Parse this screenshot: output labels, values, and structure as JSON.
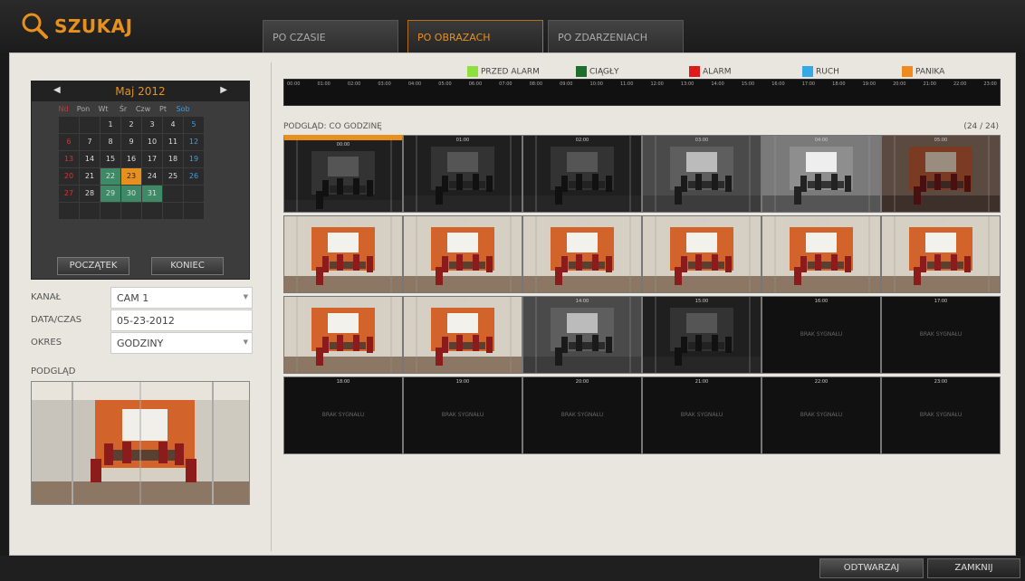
{
  "header": {
    "title": "SZUKAJ",
    "tabs": [
      {
        "label": "PO CZASIE",
        "active": false
      },
      {
        "label": "PO OBRAZACH",
        "active": true
      },
      {
        "label": "PO ZDARZENIACH",
        "active": false
      }
    ]
  },
  "calendar": {
    "month": "Maj 2012",
    "weekdays": [
      "Nd",
      "Pon",
      "Wt",
      "Śr",
      "Czw",
      "Pt",
      "Sob"
    ],
    "days": [
      {
        "d": "",
        "c": "empty"
      },
      {
        "d": "",
        "c": "empty"
      },
      {
        "d": "1",
        "c": ""
      },
      {
        "d": "2",
        "c": ""
      },
      {
        "d": "3",
        "c": ""
      },
      {
        "d": "4",
        "c": ""
      },
      {
        "d": "5",
        "c": "blue"
      },
      {
        "d": "6",
        "c": "red"
      },
      {
        "d": "7",
        "c": ""
      },
      {
        "d": "8",
        "c": ""
      },
      {
        "d": "9",
        "c": ""
      },
      {
        "d": "10",
        "c": ""
      },
      {
        "d": "11",
        "c": ""
      },
      {
        "d": "12",
        "c": "blue"
      },
      {
        "d": "13",
        "c": "red"
      },
      {
        "d": "14",
        "c": ""
      },
      {
        "d": "15",
        "c": ""
      },
      {
        "d": "16",
        "c": ""
      },
      {
        "d": "17",
        "c": ""
      },
      {
        "d": "18",
        "c": ""
      },
      {
        "d": "19",
        "c": "blue"
      },
      {
        "d": "20",
        "c": "red"
      },
      {
        "d": "21",
        "c": ""
      },
      {
        "d": "22",
        "c": "green"
      },
      {
        "d": "23",
        "c": "sel"
      },
      {
        "d": "24",
        "c": ""
      },
      {
        "d": "25",
        "c": ""
      },
      {
        "d": "26",
        "c": "blue"
      },
      {
        "d": "27",
        "c": "red"
      },
      {
        "d": "28",
        "c": ""
      },
      {
        "d": "29",
        "c": "green"
      },
      {
        "d": "30",
        "c": "green"
      },
      {
        "d": "31",
        "c": "green"
      },
      {
        "d": "",
        "c": "empty"
      },
      {
        "d": "",
        "c": "empty"
      },
      {
        "d": "",
        "c": "empty"
      },
      {
        "d": "",
        "c": "empty"
      },
      {
        "d": "",
        "c": "empty"
      },
      {
        "d": "",
        "c": "empty"
      },
      {
        "d": "",
        "c": "empty"
      },
      {
        "d": "",
        "c": "empty"
      },
      {
        "d": "",
        "c": "empty"
      }
    ],
    "start_label": "POCZĄTEK",
    "end_label": "KONIEC"
  },
  "form": {
    "channel_label": "KANAŁ",
    "channel_value": "CAM 1",
    "datetime_label": "DATA/CZAS",
    "datetime_value": "05-23-2012",
    "period_label": "OKRES",
    "period_value": "GODZINY",
    "preview_label": "PODGLĄD"
  },
  "legend": [
    {
      "label": "PRZED ALARM",
      "color": "#8fe03c"
    },
    {
      "label": "CIĄGŁY",
      "color": "#1e6e2e"
    },
    {
      "label": "ALARM",
      "color": "#e01a1a"
    },
    {
      "label": "RUCH",
      "color": "#35a8e8"
    },
    {
      "label": "PANIKA",
      "color": "#f08a1e"
    }
  ],
  "timeline_ticks": [
    "00:00",
    "01:00",
    "02:00",
    "03:00",
    "04:00",
    "05:00",
    "06:00",
    "07:00",
    "08:00",
    "09:00",
    "10:00",
    "11:00",
    "12:00",
    "13:00",
    "14:00",
    "15:00",
    "16:00",
    "17:00",
    "18:00",
    "19:00",
    "20:00",
    "21:00",
    "22:00",
    "23:00"
  ],
  "thumbnails": {
    "title": "PODGLĄD: CO GODZINĘ",
    "count": "(24 / 24)",
    "no_signal": "BRAK SYGNAŁU",
    "items": [
      {
        "label": "00:00",
        "type": "dark",
        "active": true
      },
      {
        "label": "01:00",
        "type": "dark"
      },
      {
        "label": "02:00",
        "type": "dark"
      },
      {
        "label": "03:00",
        "type": "gray"
      },
      {
        "label": "04:00",
        "type": "lightgray"
      },
      {
        "label": "05:00",
        "type": "dimcolor"
      },
      {
        "label": "06:00",
        "type": "color"
      },
      {
        "label": "07:00",
        "type": "color"
      },
      {
        "label": "08:00",
        "type": "color"
      },
      {
        "label": "09:00",
        "type": "color"
      },
      {
        "label": "10:00",
        "type": "color"
      },
      {
        "label": "11:00",
        "type": "color"
      },
      {
        "label": "12:00",
        "type": "color"
      },
      {
        "label": "13:00",
        "type": "color"
      },
      {
        "label": "14:00",
        "type": "gray"
      },
      {
        "label": "15:00",
        "type": "dark"
      },
      {
        "label": "16:00",
        "type": "nosig"
      },
      {
        "label": "17:00",
        "type": "nosig"
      },
      {
        "label": "18:00",
        "type": "nosig"
      },
      {
        "label": "19:00",
        "type": "nosig"
      },
      {
        "label": "20:00",
        "type": "nosig"
      },
      {
        "label": "21:00",
        "type": "nosig"
      },
      {
        "label": "22:00",
        "type": "nosig"
      },
      {
        "label": "23:00",
        "type": "nosig"
      }
    ]
  },
  "buttons": {
    "play": "ODTWARZAJ",
    "close": "ZAMKNIJ"
  }
}
